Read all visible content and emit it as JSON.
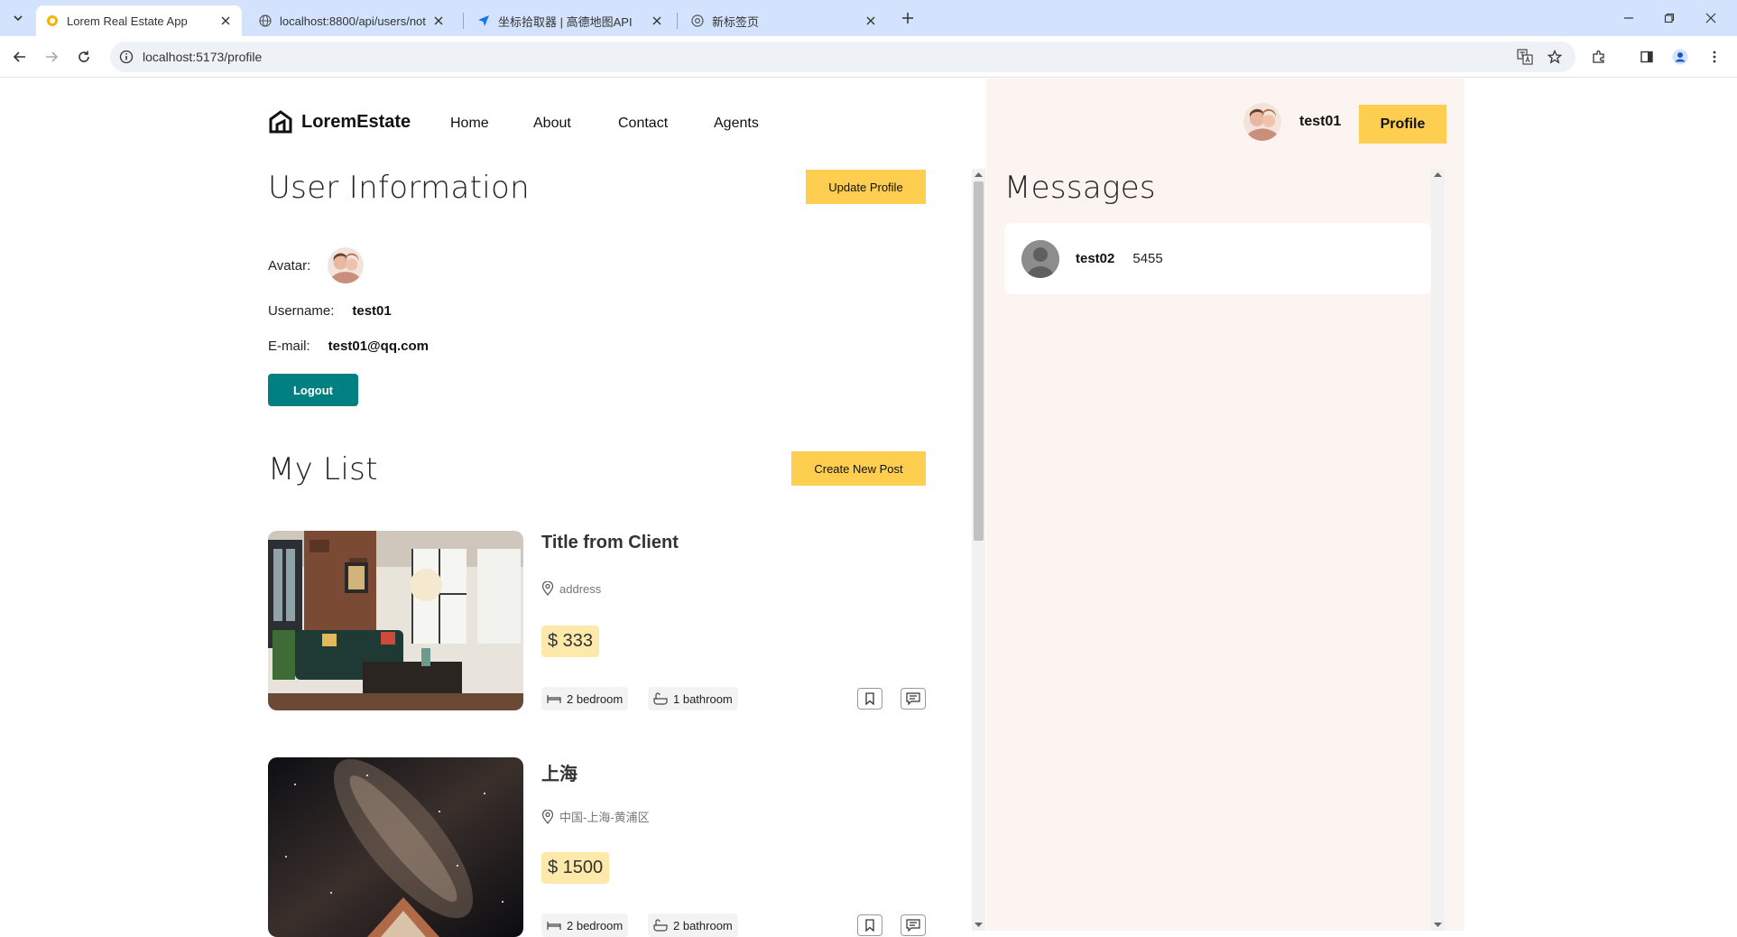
{
  "browser": {
    "tabs": [
      {
        "title": "Lorem Real Estate App",
        "active": true
      },
      {
        "title": "localhost:8800/api/users/not"
      },
      {
        "title": "坐标拾取器 | 高德地图API"
      },
      {
        "title": "新标签页"
      }
    ],
    "url": "localhost:5173/profile"
  },
  "header": {
    "logo_text": "LoremEstate",
    "nav": [
      "Home",
      "About",
      "Contact",
      "Agents"
    ],
    "username": "test01",
    "profile_label": "Profile"
  },
  "user_info": {
    "title": "User Information",
    "update_label": "Update Profile",
    "avatar_label": "Avatar:",
    "username_label": "Username:",
    "username": "test01",
    "email_label": "E-mail:",
    "email": "test01@qq.com",
    "logout_label": "Logout"
  },
  "my_list": {
    "title": "My List",
    "create_label": "Create New Post",
    "posts": [
      {
        "title": "Title from Client",
        "address": "address",
        "price": "$ 333",
        "bedroom": "2 bedroom",
        "bathroom": "1 bathroom"
      },
      {
        "title": "上海",
        "address": "中国-上海-黄浦区",
        "price": "$ 1500",
        "bedroom": "2 bedroom",
        "bathroom": "2 bathroom"
      }
    ]
  },
  "messages": {
    "title": "Messages",
    "items": [
      {
        "user": "test02",
        "text": "5455"
      }
    ]
  },
  "colors": {
    "accent_yellow": "#fece51",
    "logout_teal": "#008080",
    "chat_bg": "#fcf4f1"
  }
}
